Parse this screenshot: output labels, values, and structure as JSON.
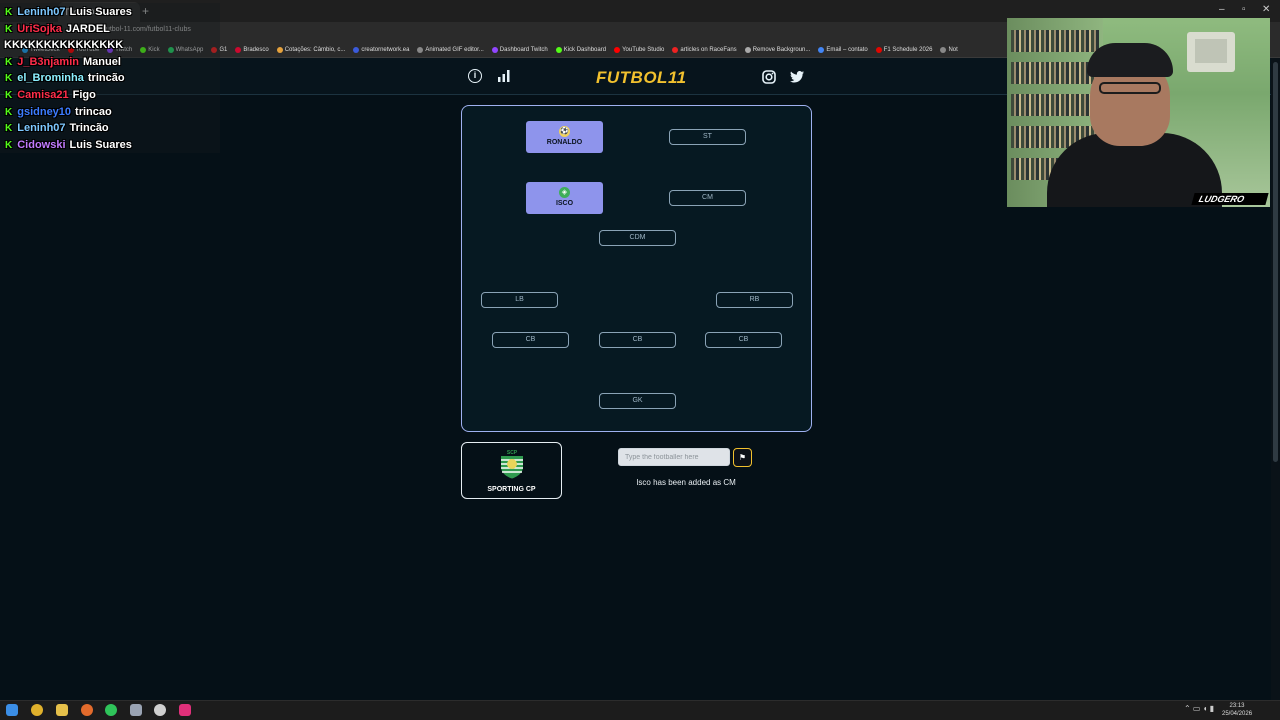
{
  "browser": {
    "tab_title": "TweetDeck",
    "url": "futbol-11.com/futbol11-clubs",
    "bookmarks": [
      "TweetDeck",
      "YouTube",
      "Twitch",
      "Kick",
      "WhatsApp",
      "G1",
      "Bradesco",
      "Cotações: Câmbio, c...",
      "creatornetwork.ea",
      "Animated GIF editor...",
      "Dashboard Twitch",
      "Kick Dashboard",
      "YouTube Studio",
      "articles on RaceFans",
      "Remove Backgroun...",
      "Email – contato",
      "F1 Schedule 2026",
      "Not"
    ]
  },
  "header": {
    "logo": "FUTBOL",
    "logo_accent": "11"
  },
  "pitch": {
    "filled": [
      {
        "position": "ST",
        "player": "RONALDO"
      },
      {
        "position": "CM",
        "player": "ISCO"
      }
    ],
    "slots": [
      "ST",
      "CM",
      "CDM",
      "LB",
      "RB",
      "CB",
      "CB",
      "CB",
      "GK"
    ]
  },
  "club": {
    "name": "SPORTING CP",
    "crest_text": "SCP"
  },
  "guess": {
    "placeholder": "Type the footballer here",
    "value": ""
  },
  "status": "Isco has been added as CM",
  "chat": [
    {
      "user": "Leninh07",
      "color": "#7dc8ff",
      "message": "Luis Suares"
    },
    {
      "user": "UriSojka",
      "color": "#ff2d4a",
      "message": "JARDEL"
    },
    {
      "user": "",
      "color": "#ffffff",
      "message": "KKKKKKKKKKKKKKK"
    },
    {
      "user": "J_B3njamin",
      "color": "#ff2d4a",
      "message": "Manuel"
    },
    {
      "user": "el_Brominha",
      "color": "#8cf0ff",
      "message": "trincão"
    },
    {
      "user": "Camisa21",
      "color": "#ff2d4a",
      "message": "Figo"
    },
    {
      "user": "gsidney10",
      "color": "#3c7cff",
      "message": "trincao"
    },
    {
      "user": "Leninh07",
      "color": "#7dc8ff",
      "message": "Trincão"
    },
    {
      "user": "Cidowski",
      "color": "#c07bff",
      "message": "Luis Suares"
    }
  ],
  "webcam": {
    "overlay_logo": "LUDGERO"
  },
  "taskbar": {
    "time": "23:13",
    "date": "25/04/2026"
  },
  "colors": {
    "accent": "#f2c12e",
    "pitch_border": "#9fb1f0",
    "card": "#8e94ec",
    "kick_green": "#53fc18"
  }
}
